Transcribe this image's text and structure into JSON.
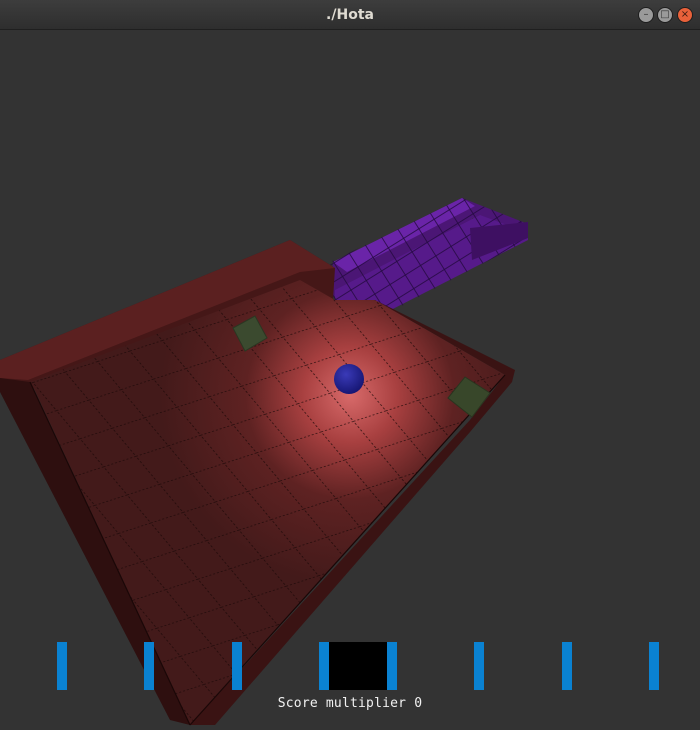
{
  "window": {
    "title": "./Hota"
  },
  "titlebar_icons": [
    "minimize-icon",
    "maximize-icon",
    "close-icon"
  ],
  "hud": {
    "score_label": "Score multiplier 0",
    "meter_markers": 8,
    "colors": {
      "marker": "#0a82d2",
      "indicator": "#000000"
    }
  },
  "scene": {
    "floor_color": "#4a1c1c",
    "bridge_color": "#5a1a8a",
    "ball_color": "#1a1a8c",
    "pickup_color": "#3a4a30",
    "light_color": "#e07070"
  }
}
